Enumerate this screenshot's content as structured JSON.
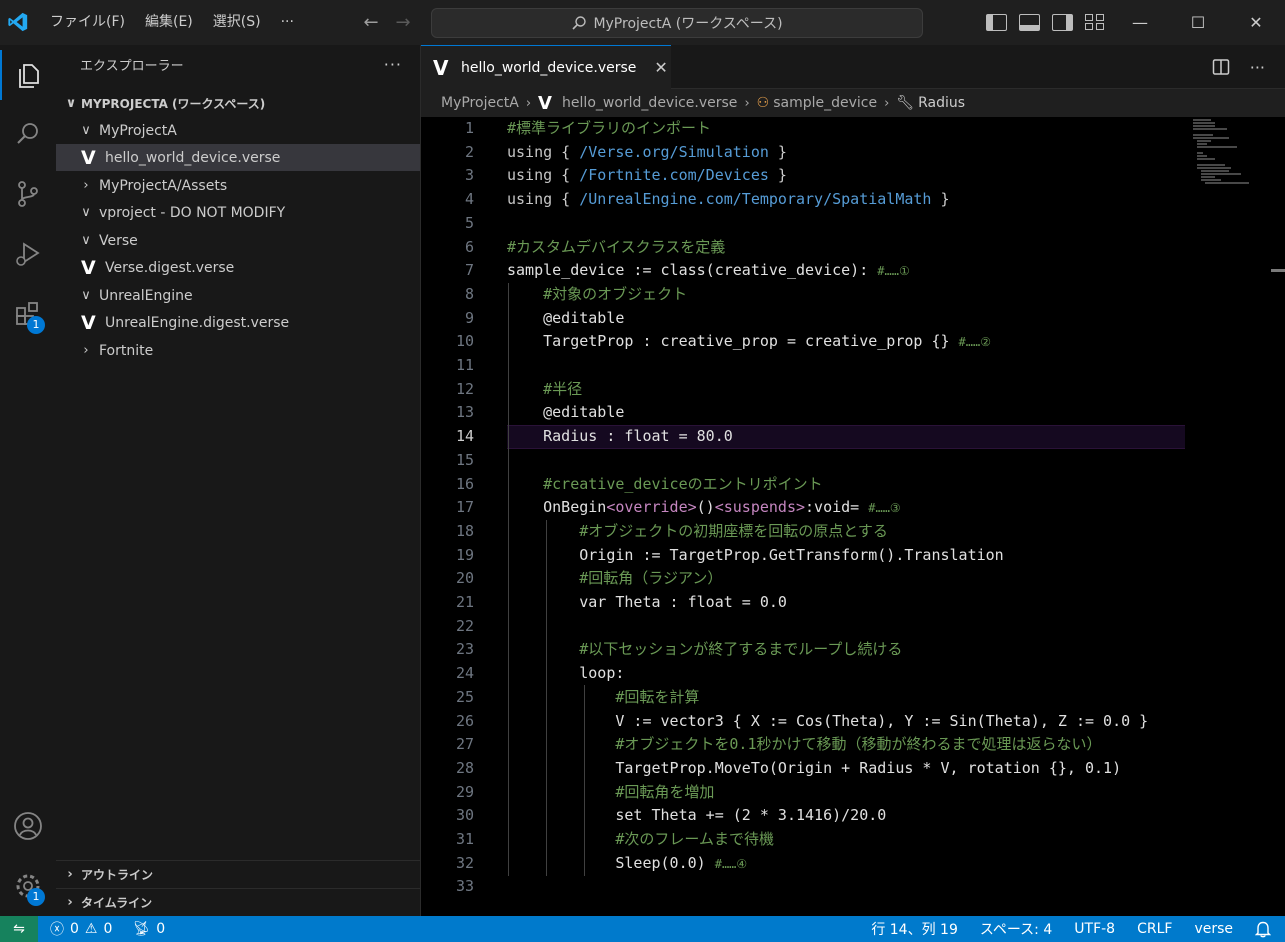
{
  "titlebar": {
    "menu": [
      "ファイル(F)",
      "編集(E)",
      "選択(S)",
      "···"
    ],
    "search": "MyProjectA (ワークスペース)",
    "window_controls": [
      "—",
      "☐",
      "✕"
    ]
  },
  "activity": {
    "extensions_badge": "1",
    "settings_badge": "1"
  },
  "sidebar": {
    "title": "エクスプローラー",
    "more": "···",
    "workspace": "MYPROJECTA (ワークスペース)",
    "items": [
      {
        "label": "MyProjectA",
        "chevron": "∨"
      },
      {
        "label": "hello_world_device.verse",
        "file": true
      },
      {
        "label": "MyProjectA/Assets",
        "chevron": "›"
      },
      {
        "label": "vproject - DO NOT MODIFY",
        "chevron": "∨"
      },
      {
        "label": "Verse",
        "chevron": "∨"
      },
      {
        "label": "Verse.digest.verse",
        "file": true
      },
      {
        "label": "UnrealEngine",
        "chevron": "∨"
      },
      {
        "label": "UnrealEngine.digest.verse",
        "file": true
      },
      {
        "label": "Fortnite",
        "chevron": "›"
      }
    ],
    "outline": "アウトライン",
    "timeline": "タイムライン"
  },
  "tab": {
    "label": "hello_world_device.verse",
    "close": "✕"
  },
  "breadcrumb": {
    "project": "MyProjectA",
    "file": "hello_world_device.verse",
    "class": "sample_device",
    "member": "Radius"
  },
  "editor": {
    "line_numbers": [
      "1",
      "2",
      "3",
      "4",
      "5",
      "6",
      "7",
      "8",
      "9",
      "10",
      "11",
      "12",
      "13",
      "14",
      "15",
      "16",
      "17",
      "18",
      "19",
      "20",
      "21",
      "22",
      "23",
      "24",
      "25",
      "26",
      "27",
      "28",
      "29",
      "30",
      "31",
      "32",
      "33"
    ],
    "current_line": 14
  },
  "status": {
    "errors": "0",
    "warnings": "0",
    "ports": "0",
    "position": "行 14、列 19",
    "spaces": "スペース: 4",
    "encoding": "UTF-8",
    "eol": "CRLF",
    "language": "verse"
  },
  "colors": {
    "accent": "#007acc",
    "remote": "#16825d",
    "current_line_bg": "#150920"
  }
}
